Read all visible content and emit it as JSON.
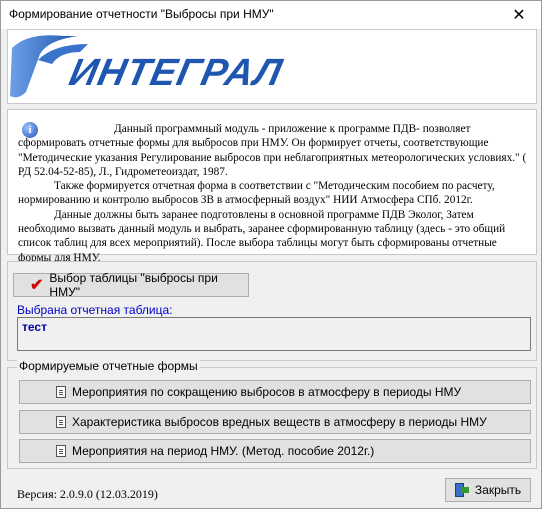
{
  "window": {
    "title": "Формирование отчетности \"Выбросы при НМУ\"",
    "close_glyph": "✕"
  },
  "banner": {
    "logo_text": "ИНТЕГРАЛ",
    "logo_color": "#1e56b0"
  },
  "info": {
    "icon": "info-icon",
    "paragraphs": [
      "Данный программный модуль - приложение к программе ПДВ- позволяет сформировать отчетные формы для выбросов при НМУ. Он формирует отчеты, соответствующие \"Методические указания Регулирование выбросов при неблагоприятных метеорологических условиях.\" ( РД 52.04-52-85), Л., Гидрометеоиздат, 1987.",
      "Также формируется отчетная форма в соответствии с \"Методическим пособием по расчету, нормированию и контролю выбросов ЗВ в атмосферный воздух\" НИИ Атмосфера СПб. 2012г.",
      "Данные должны быть заранее подготовлены в основной программе ПДВ Эколог, Затем необходимо вызвать данный модуль и выбрать, заранее сформированную таблицу (здесь -  это общий список таблиц для всех мероприятий). После выбора таблицы могут быть сформированы отчетные формы для НМУ."
    ]
  },
  "select": {
    "button_label": "Выбор таблицы \"выбросы при НМУ\"",
    "selected_label": "Выбрана отчетная таблица:",
    "selected_value": "тест"
  },
  "forms": {
    "caption": "Формируемые отчетные формы",
    "buttons": [
      "Мероприятия по сокращению выбросов в атмосферу в периоды НМУ",
      "Характеристика выбросов вредных веществ в атмосферу в периоды НМУ",
      "Мероприятия на период НМУ. (Метод. пособие 2012г.)"
    ]
  },
  "footer": {
    "version": "Версия:  2.0.9.0  (12.03.2019)",
    "close_label": "Закрыть"
  }
}
